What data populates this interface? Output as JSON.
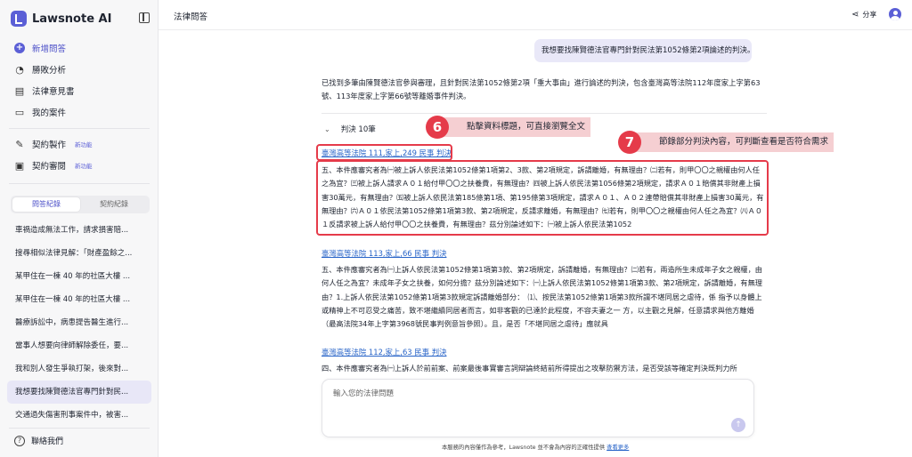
{
  "brand": {
    "name": "Lawsnote AI"
  },
  "nav": {
    "new_chat": "新增問答",
    "win_analysis": "勝敗分析",
    "legal_opinion": "法律意見書",
    "my_cases": "我的案件",
    "contract_make": "契約製作",
    "contract_review": "契約審閱",
    "new_badge": "新功能"
  },
  "tabs": {
    "qa_history": "問答紀錄",
    "contract_history": "契約紀錄"
  },
  "history": [
    "車禍造成無法工作，請求損害賠...",
    "搜尋相似法律見解：「財產盈餘之...",
    "某甲住在一棟 40 年的社區大樓 ...",
    "某甲住在一棟 40 年的社區大樓 ...",
    "醫療訴訟中，病患提告醫生進行...",
    "當事人想要向律師解除委任，要...",
    "我和別人發生爭執打架，後來對...",
    "我想要找陳賢德法官專門針對民...",
    "交通過失傷害刑事案件中，被害..."
  ],
  "contact": "聯絡我們",
  "header": {
    "title": "法律問答",
    "share": "分享"
  },
  "user_message": "我想要找陳賢德法官專門針對民法第1052條第2項論述的判決。",
  "answer": "已找到多筆由陳賢德法官參與審理，且針對民法第1052條第2項「重大事由」進行論述的判決，包含臺灣高等法院112年度家上字第63號、113年度家上字第66號等離婚事件判決。",
  "verdicts": {
    "header": "判決 10筆",
    "items": [
      {
        "title": "臺灣高等法院 111,家上,249 民事 判決",
        "text": "五、本件應審究者為㈠被上訴人依民法第1052條第1項第2、3款、第2項規定，訴請離婚，有無理由？㈡若有，則甲〇〇之親權由何人任之為宜？㈢被上訴人請求Ａ０１給付甲〇〇之扶養費，有無理由？㈣被上訴人依民法第1056條第2項規定，請求Ａ０１賠償其非財產上損害30萬元，有無理由？㈤被上訴人依民法第185條第1項、第195條第3項規定，請求Ａ０１、Ａ０２連帶賠償其非財產上損害30萬元，有無理由？㈥Ａ０１依民法第1052條第1項第3款、第2項規定，反請求離婚，有無理由？㈦若有，則甲〇〇之親權由何人任之為宜？㈧Ａ０１反請求被上訴人給付甲〇〇之扶養費，有無理由？茲分別論述如下：㈠被上訴人依民法第1052"
      },
      {
        "title": "臺灣高等法院 113,家上,66 民事 判決",
        "text": "五、本件應審究者為㈠上訴人依民法第1052條第1項第3款、第2項規定，訴請離婚，有無理由？㈡若有，兩造所生未成年子女之親權，由何人任之為宜？未成年子女之扶養，如何分擔？茲分別論述如下：㈠上訴人依民法第1052條第1項第3款、第2項規定，訴請離婚，有無理由？1.上訴人依民法第1052條第1項第3款規定訴請離婚部分：　⑴、按民法第1052條第1項第3款所謂不堪同居之虐待，係 指予以身體上或精神上不可忍受之痛苦，致不堪繼續同居者而言，如非客觀的已達於此程度，不容夫妻之一 方，以主觀之見解，任意請求與他方離婚（最高法院34年上字第3968號民事判例意旨參照）。且，是否「不堪同居之虐待」應就具"
      },
      {
        "title": "臺灣高等法院 112,家上,63 民事 判決",
        "text": "四、本件應審究者為㈠上訴人於前前案、前案最後事實審言詞辯論終結前所得提出之攻擊防禦方法，是否受該等確定判決既判力所"
      }
    ]
  },
  "callouts": {
    "c6": {
      "num": "6",
      "text": "點擊資料標題，可直接瀏覽全文"
    },
    "c7": {
      "num": "7",
      "text": "節錄部分判決內容，可判斷查看是否符合需求"
    }
  },
  "input": {
    "placeholder": "輸入您的法律問題",
    "value": ""
  },
  "disclaimer": {
    "text": "本服務的內容僅作為參考，Lawsnote 並不會為內容的正確性提供",
    "link": "查看更多"
  },
  "colors": {
    "accent": "#5b5fd6",
    "link": "#2864c8",
    "annotation_red": "#e53b4a",
    "annotation_fill": "#f5cfd2"
  }
}
